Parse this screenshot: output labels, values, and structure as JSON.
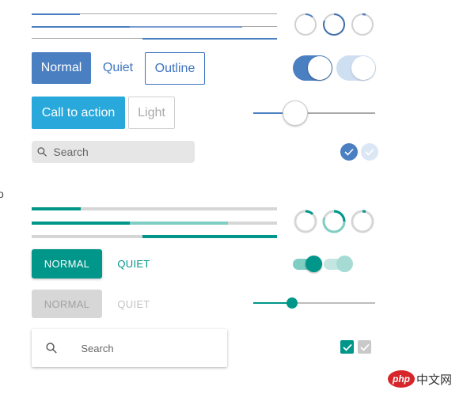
{
  "colors": {
    "blue": "#4a7fc1",
    "blue_light": "#cfdff2",
    "cyan": "#29a8db",
    "teal": "#00968a",
    "teal_light": "#7fcdc3",
    "gray_track": "#cfcfcf",
    "gray_btn": "#d7d7d7"
  },
  "section1": {
    "progress": [
      {
        "value": 0.22
      },
      {
        "value": 0.42,
        "buffer": 0.86
      },
      {
        "start": 0.45,
        "end": 1.0
      }
    ],
    "spinners": [
      {
        "icon": "spinner-small-arc-icon"
      },
      {
        "icon": "spinner-large-arc-icon"
      },
      {
        "icon": "spinner-tiny-arc-icon"
      }
    ],
    "buttons": {
      "normal": "Normal",
      "quiet": "Quiet",
      "outline": "Outline",
      "cta": "Call to action",
      "light": "Light"
    },
    "toggles": [
      {
        "state": "on"
      },
      {
        "state": "on-disabled"
      }
    ],
    "slider": {
      "value": 0.33
    },
    "search": {
      "placeholder": "Search",
      "icon": "search-icon"
    },
    "checkboxes": [
      {
        "checked": true,
        "disabled": false
      },
      {
        "checked": true,
        "disabled": true
      }
    ]
  },
  "side_glyph": "o",
  "section2": {
    "progress": [
      {
        "value": 0.22
      },
      {
        "value": 0.4,
        "buffer": 0.8
      },
      {
        "start": 0.45,
        "end": 1.0
      }
    ],
    "spinners": [
      {
        "icon": "spinner-small-arc-icon"
      },
      {
        "icon": "spinner-large-arc-icon"
      },
      {
        "icon": "spinner-tiny-arc-icon"
      }
    ],
    "buttons": {
      "normal": "NORMAL",
      "quiet": "QUIET",
      "normal_disabled": "NORMAL",
      "quiet_disabled": "QUIET"
    },
    "toggles": [
      {
        "state": "on"
      },
      {
        "state": "on-disabled"
      }
    ],
    "slider": {
      "value": 0.31
    },
    "search": {
      "placeholder": "Search",
      "icon": "search-icon"
    },
    "checkboxes": [
      {
        "checked": true,
        "disabled": false
      },
      {
        "checked": true,
        "disabled": true
      }
    ]
  },
  "watermark": {
    "logo_text": "php",
    "site_text": "中文网"
  }
}
